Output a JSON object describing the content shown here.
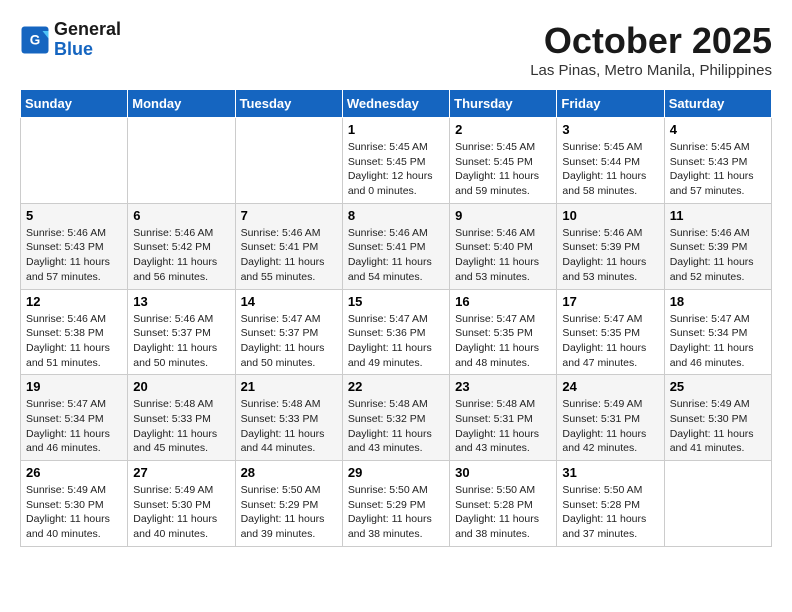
{
  "header": {
    "logo_line1": "General",
    "logo_line2": "Blue",
    "month": "October 2025",
    "location": "Las Pinas, Metro Manila, Philippines"
  },
  "weekdays": [
    "Sunday",
    "Monday",
    "Tuesday",
    "Wednesday",
    "Thursday",
    "Friday",
    "Saturday"
  ],
  "weeks": [
    [
      {
        "day": "",
        "info": ""
      },
      {
        "day": "",
        "info": ""
      },
      {
        "day": "",
        "info": ""
      },
      {
        "day": "1",
        "info": "Sunrise: 5:45 AM\nSunset: 5:45 PM\nDaylight: 12 hours\nand 0 minutes."
      },
      {
        "day": "2",
        "info": "Sunrise: 5:45 AM\nSunset: 5:45 PM\nDaylight: 11 hours\nand 59 minutes."
      },
      {
        "day": "3",
        "info": "Sunrise: 5:45 AM\nSunset: 5:44 PM\nDaylight: 11 hours\nand 58 minutes."
      },
      {
        "day": "4",
        "info": "Sunrise: 5:45 AM\nSunset: 5:43 PM\nDaylight: 11 hours\nand 57 minutes."
      }
    ],
    [
      {
        "day": "5",
        "info": "Sunrise: 5:46 AM\nSunset: 5:43 PM\nDaylight: 11 hours\nand 57 minutes."
      },
      {
        "day": "6",
        "info": "Sunrise: 5:46 AM\nSunset: 5:42 PM\nDaylight: 11 hours\nand 56 minutes."
      },
      {
        "day": "7",
        "info": "Sunrise: 5:46 AM\nSunset: 5:41 PM\nDaylight: 11 hours\nand 55 minutes."
      },
      {
        "day": "8",
        "info": "Sunrise: 5:46 AM\nSunset: 5:41 PM\nDaylight: 11 hours\nand 54 minutes."
      },
      {
        "day": "9",
        "info": "Sunrise: 5:46 AM\nSunset: 5:40 PM\nDaylight: 11 hours\nand 53 minutes."
      },
      {
        "day": "10",
        "info": "Sunrise: 5:46 AM\nSunset: 5:39 PM\nDaylight: 11 hours\nand 53 minutes."
      },
      {
        "day": "11",
        "info": "Sunrise: 5:46 AM\nSunset: 5:39 PM\nDaylight: 11 hours\nand 52 minutes."
      }
    ],
    [
      {
        "day": "12",
        "info": "Sunrise: 5:46 AM\nSunset: 5:38 PM\nDaylight: 11 hours\nand 51 minutes."
      },
      {
        "day": "13",
        "info": "Sunrise: 5:46 AM\nSunset: 5:37 PM\nDaylight: 11 hours\nand 50 minutes."
      },
      {
        "day": "14",
        "info": "Sunrise: 5:47 AM\nSunset: 5:37 PM\nDaylight: 11 hours\nand 50 minutes."
      },
      {
        "day": "15",
        "info": "Sunrise: 5:47 AM\nSunset: 5:36 PM\nDaylight: 11 hours\nand 49 minutes."
      },
      {
        "day": "16",
        "info": "Sunrise: 5:47 AM\nSunset: 5:35 PM\nDaylight: 11 hours\nand 48 minutes."
      },
      {
        "day": "17",
        "info": "Sunrise: 5:47 AM\nSunset: 5:35 PM\nDaylight: 11 hours\nand 47 minutes."
      },
      {
        "day": "18",
        "info": "Sunrise: 5:47 AM\nSunset: 5:34 PM\nDaylight: 11 hours\nand 46 minutes."
      }
    ],
    [
      {
        "day": "19",
        "info": "Sunrise: 5:47 AM\nSunset: 5:34 PM\nDaylight: 11 hours\nand 46 minutes."
      },
      {
        "day": "20",
        "info": "Sunrise: 5:48 AM\nSunset: 5:33 PM\nDaylight: 11 hours\nand 45 minutes."
      },
      {
        "day": "21",
        "info": "Sunrise: 5:48 AM\nSunset: 5:33 PM\nDaylight: 11 hours\nand 44 minutes."
      },
      {
        "day": "22",
        "info": "Sunrise: 5:48 AM\nSunset: 5:32 PM\nDaylight: 11 hours\nand 43 minutes."
      },
      {
        "day": "23",
        "info": "Sunrise: 5:48 AM\nSunset: 5:31 PM\nDaylight: 11 hours\nand 43 minutes."
      },
      {
        "day": "24",
        "info": "Sunrise: 5:49 AM\nSunset: 5:31 PM\nDaylight: 11 hours\nand 42 minutes."
      },
      {
        "day": "25",
        "info": "Sunrise: 5:49 AM\nSunset: 5:30 PM\nDaylight: 11 hours\nand 41 minutes."
      }
    ],
    [
      {
        "day": "26",
        "info": "Sunrise: 5:49 AM\nSunset: 5:30 PM\nDaylight: 11 hours\nand 40 minutes."
      },
      {
        "day": "27",
        "info": "Sunrise: 5:49 AM\nSunset: 5:30 PM\nDaylight: 11 hours\nand 40 minutes."
      },
      {
        "day": "28",
        "info": "Sunrise: 5:50 AM\nSunset: 5:29 PM\nDaylight: 11 hours\nand 39 minutes."
      },
      {
        "day": "29",
        "info": "Sunrise: 5:50 AM\nSunset: 5:29 PM\nDaylight: 11 hours\nand 38 minutes."
      },
      {
        "day": "30",
        "info": "Sunrise: 5:50 AM\nSunset: 5:28 PM\nDaylight: 11 hours\nand 38 minutes."
      },
      {
        "day": "31",
        "info": "Sunrise: 5:50 AM\nSunset: 5:28 PM\nDaylight: 11 hours\nand 37 minutes."
      },
      {
        "day": "",
        "info": ""
      }
    ]
  ]
}
